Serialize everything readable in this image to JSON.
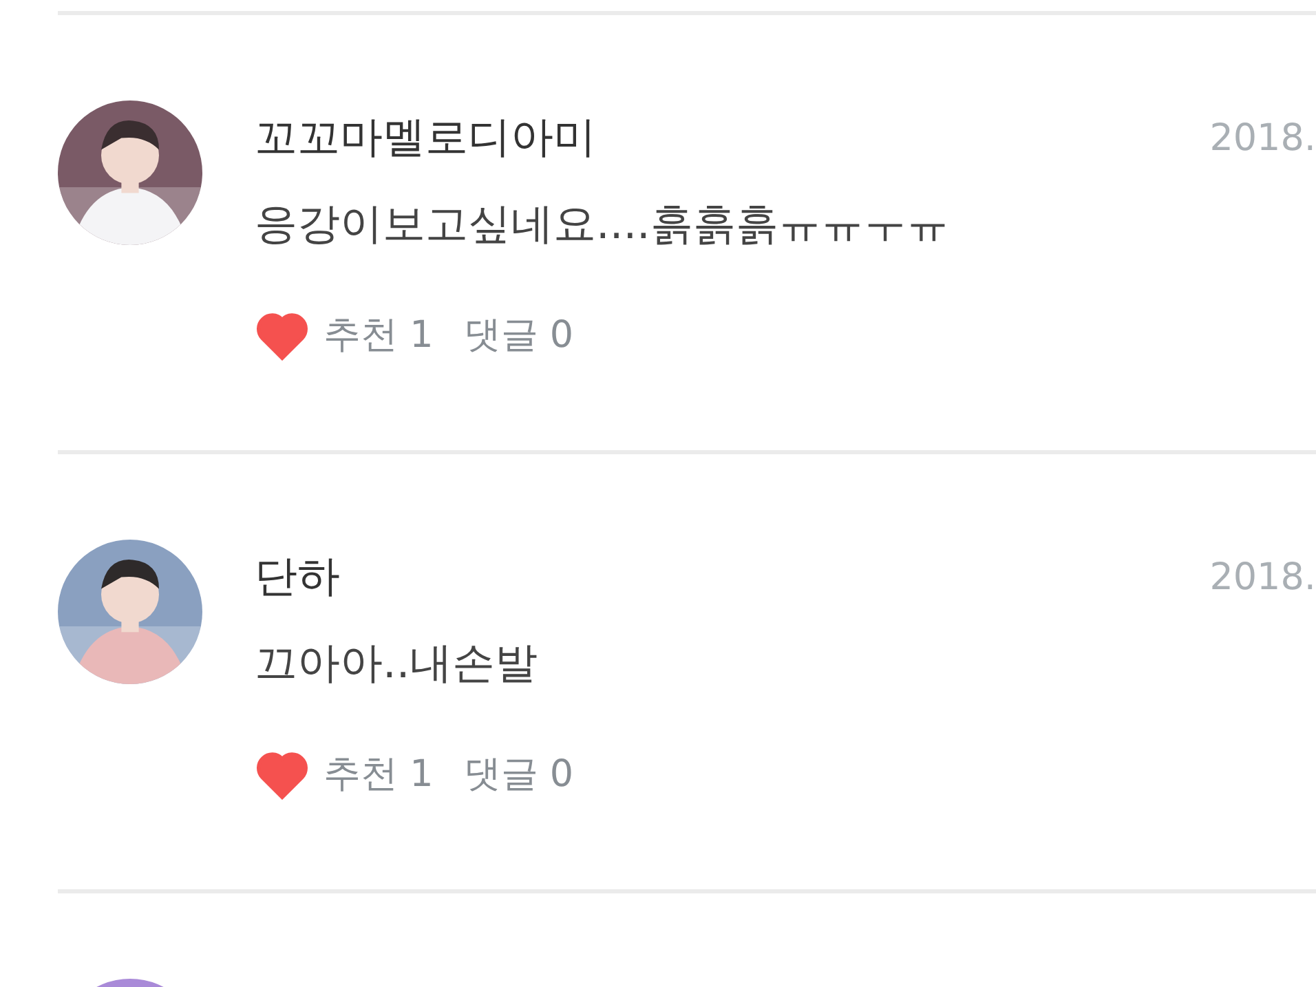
{
  "comments": [
    {
      "avatar": {
        "kind": "picture"
      },
      "author": "꼬꼬마멜로디아미",
      "date": "2018.",
      "text": "응강이보고싶네요....흙흙흙ㅠㅠㅜㅠ",
      "liked": true,
      "likes_label": "추천 1",
      "replies_label": "댓글 0"
    },
    {
      "avatar": {
        "kind": "picture"
      },
      "author": "단하",
      "date": "2018.",
      "text": "끄아아..내손발",
      "liked": true,
      "likes_label": "추천 1",
      "replies_label": "댓글 0"
    },
    {
      "avatar": {
        "kind": "picture"
      }
    }
  ]
}
